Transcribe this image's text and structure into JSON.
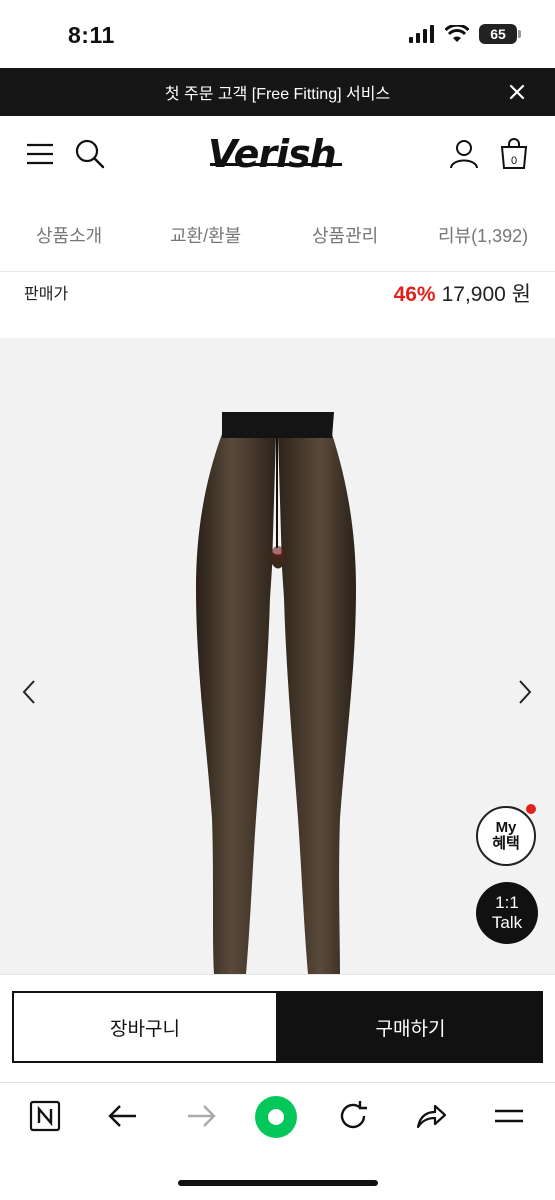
{
  "status_bar": {
    "time": "8:11",
    "battery": "65"
  },
  "promo_banner": {
    "text": "첫 주문 고객 [Free Fitting] 서비스"
  },
  "header": {
    "logo": "Verish"
  },
  "tabs": [
    {
      "label": "상품소개"
    },
    {
      "label": "교환/환불"
    },
    {
      "label": "상품관리"
    },
    {
      "label": "리뷰(1,392)"
    }
  ],
  "price": {
    "label": "판매가",
    "discount": "46%",
    "value": "17,900 원"
  },
  "product": {
    "image": "black-sheer-tights"
  },
  "floating": {
    "my_benefit": [
      "My",
      "혜택"
    ],
    "talk": [
      "1:1",
      "Talk"
    ]
  },
  "actions": {
    "cart": "장바구니",
    "buy": "구매하기"
  },
  "colors": {
    "accent_red": "#e0211c",
    "dark": "#111111",
    "banner": "#161616",
    "talk_green": "#03c75a"
  }
}
